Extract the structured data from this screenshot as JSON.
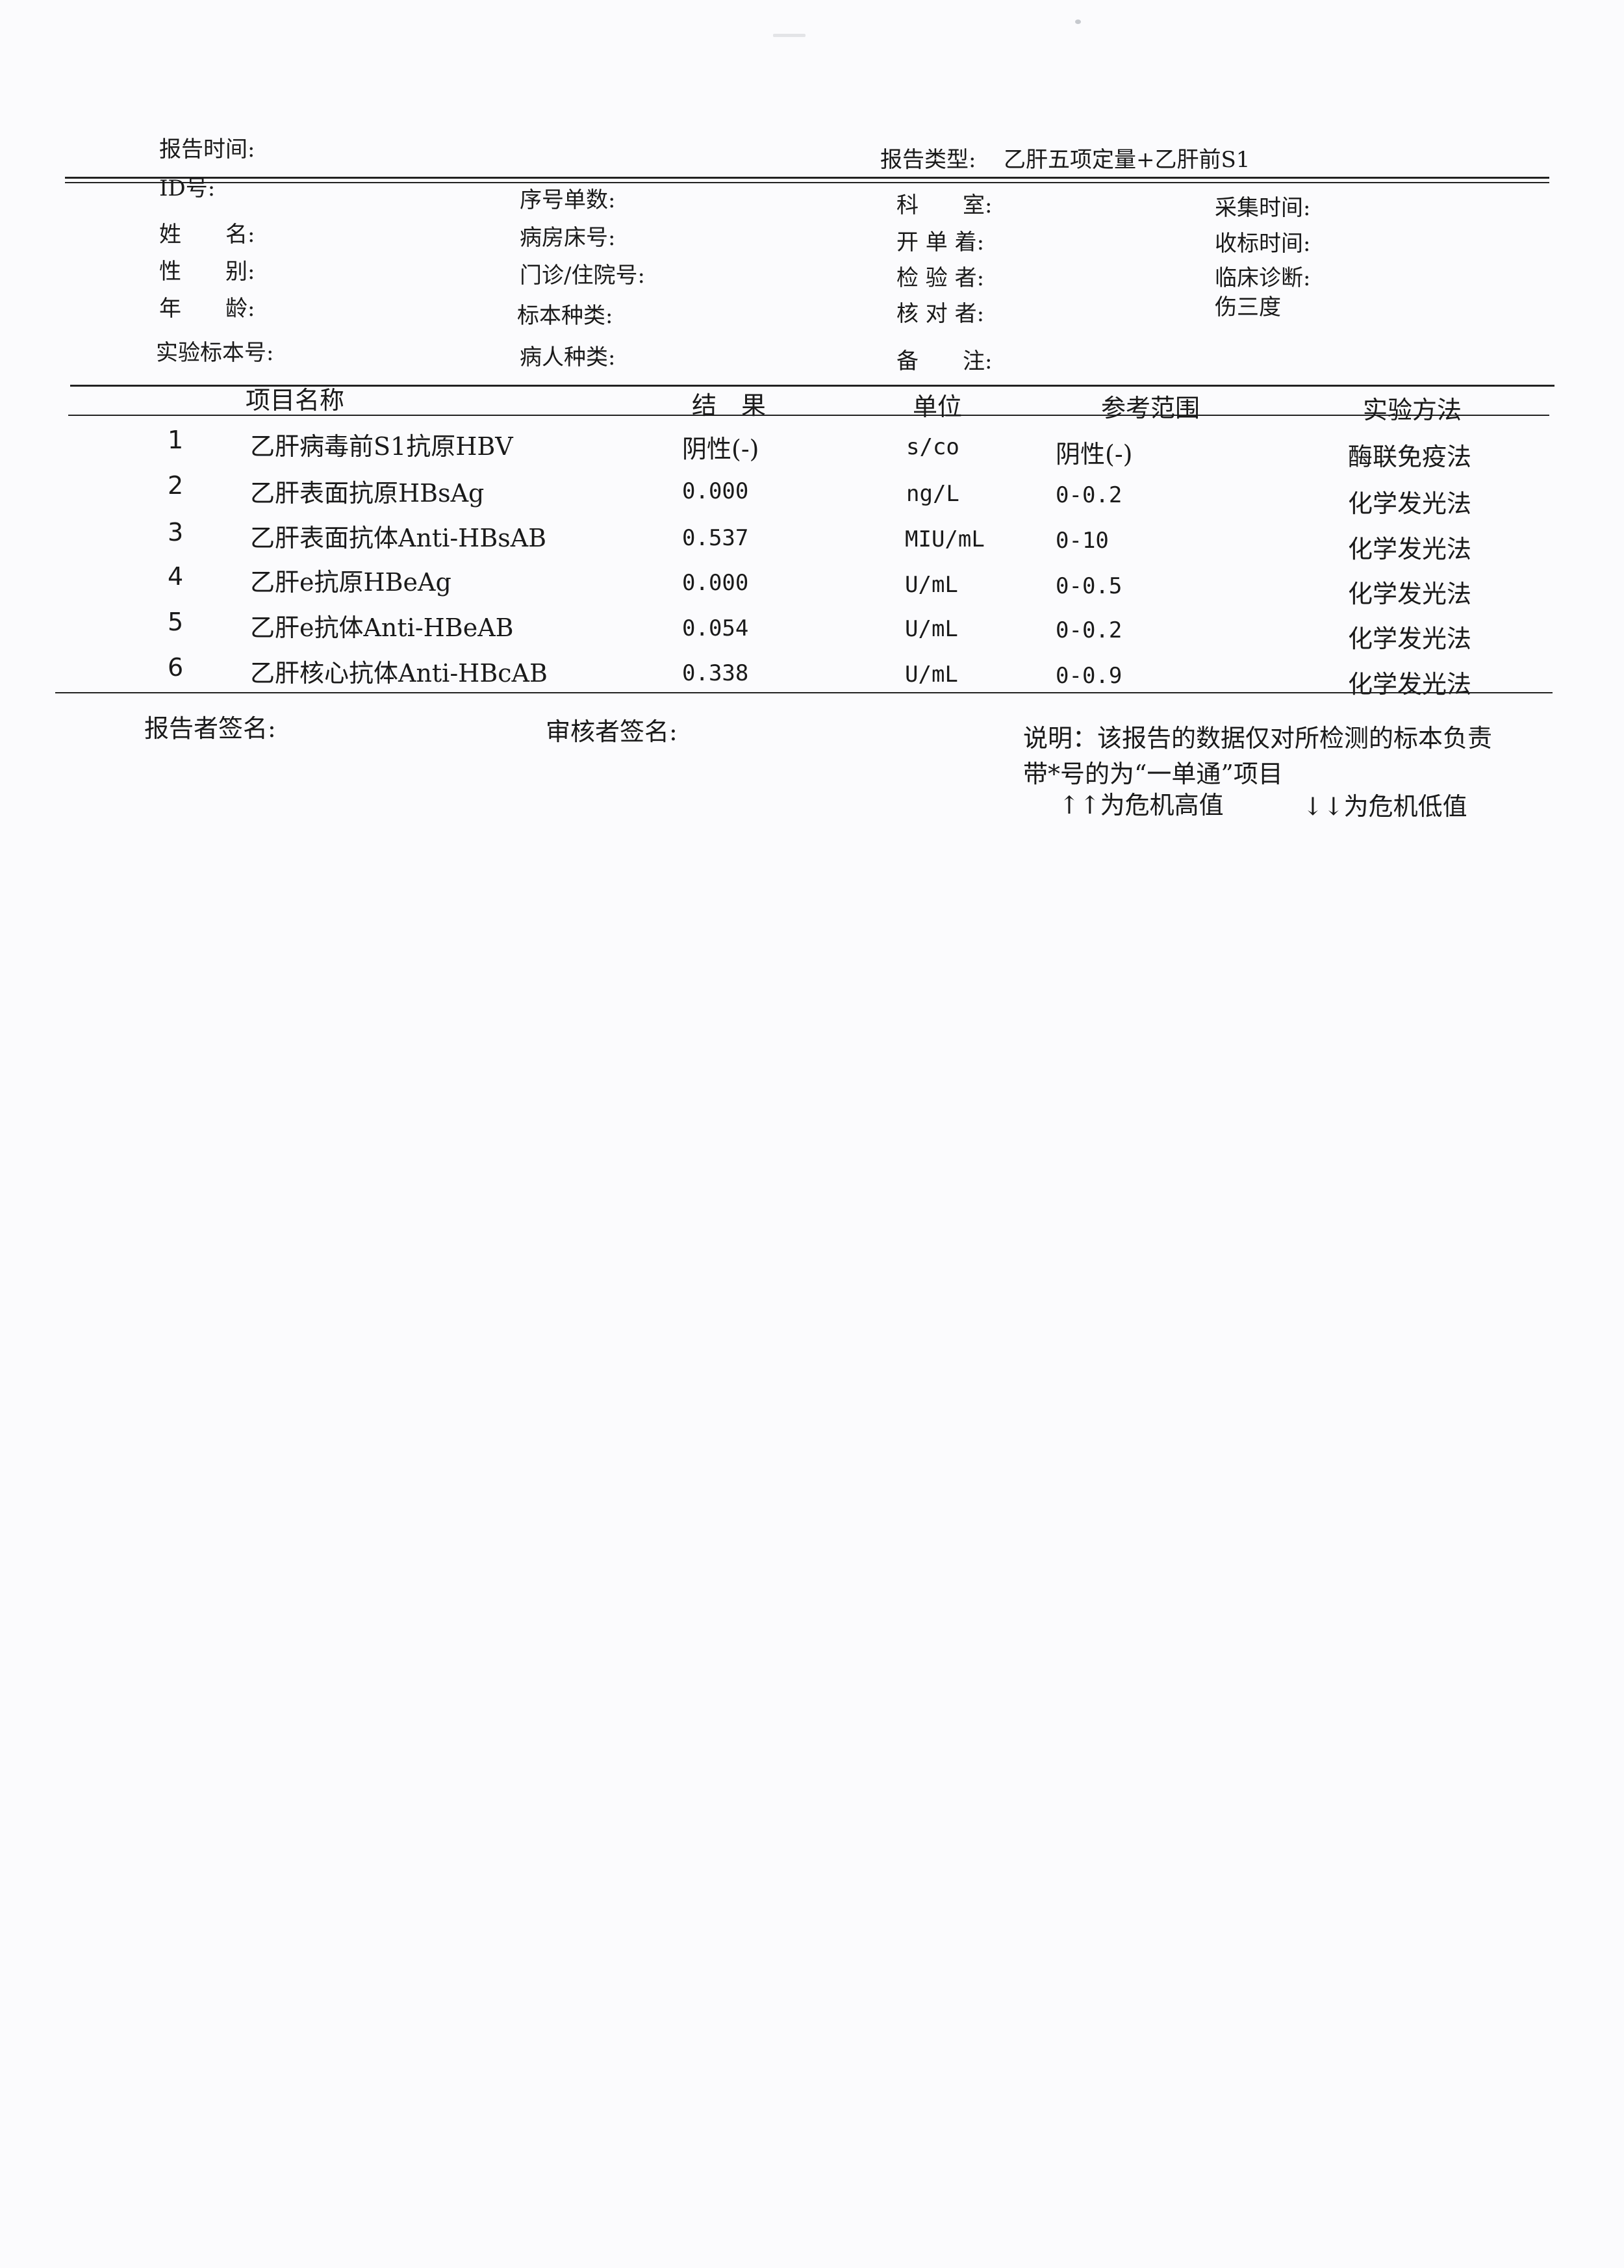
{
  "header": {
    "report_time_label": "报告时间:",
    "report_type_label": "报告类型:",
    "report_type_value": "乙肝五项定量+乙肝前S1"
  },
  "patient_info": {
    "id_label": "ID号:",
    "name_label": "姓　　名:",
    "gender_label": "性　　别:",
    "age_label": "年　　龄:",
    "sample_no_label": "实验标本号:",
    "serial_label": "序号单数:",
    "bed_label": "病房床号:",
    "clinic_label": "门诊/住院号:",
    "specimen_type_label": "标本种类:",
    "patient_type_label": "病人种类:",
    "department_label": "科　　室:",
    "ordered_by_label": "开 单 着:",
    "tested_by_label": "检 验 者:",
    "checked_by_label": "核 对 者:",
    "remark_label": "备　　注:",
    "collect_time_label": "采集时间:",
    "receive_time_label": "收标时间:",
    "diagnosis_label": "临床诊断:",
    "diagnosis_value": "伤三度"
  },
  "table": {
    "headers": {
      "item": "项目名称",
      "result": "结　果",
      "unit": "单位",
      "reference": "参考范围",
      "method": "实验方法"
    },
    "rows": [
      {
        "no": "1",
        "item": "乙肝病毒前S1抗原HBV",
        "result": "阴性(-)",
        "unit": "s/co",
        "reference": "阴性(-)",
        "method": "酶联免疫法"
      },
      {
        "no": "2",
        "item": "乙肝表面抗原HBsAg",
        "result": "0.000",
        "unit": "ng/L",
        "reference": "0-0.2",
        "method": "化学发光法"
      },
      {
        "no": "3",
        "item": "乙肝表面抗体Anti-HBsAB",
        "result": "0.537",
        "unit": "MIU/mL",
        "reference": "0-10",
        "method": "化学发光法"
      },
      {
        "no": "4",
        "item": "乙肝e抗原HBeAg",
        "result": "0.000",
        "unit": "U/mL",
        "reference": "0-0.5",
        "method": "化学发光法"
      },
      {
        "no": "5",
        "item": "乙肝e抗体Anti-HBeAB",
        "result": "0.054",
        "unit": "U/mL",
        "reference": "0-0.2",
        "method": "化学发光法"
      },
      {
        "no": "6",
        "item": "乙肝核心抗体Anti-HBcAB",
        "result": "0.338",
        "unit": "U/mL",
        "reference": "0-0.9",
        "method": "化学发光法"
      }
    ]
  },
  "footer": {
    "reporter_sign_label": "报告者签名:",
    "reviewer_sign_label": "审核者签名:",
    "note_line1": "说明：该报告的数据仅对所检测的标本负责",
    "note_line2": "带*号的为“一单通”项目",
    "critical_high": "↑↑为危机高值",
    "critical_low": "↓↓为危机低值"
  }
}
